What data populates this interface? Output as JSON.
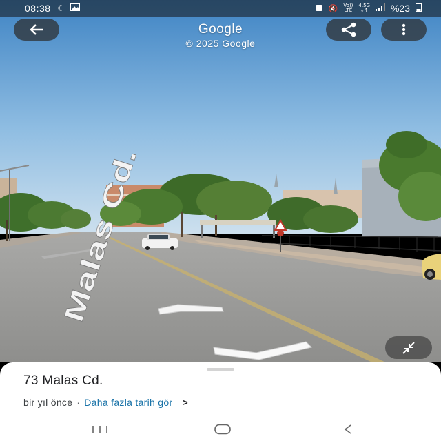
{
  "status_bar": {
    "time": "08:38",
    "left_icons": [
      "moon-icon",
      "image-icon"
    ],
    "network_labels": [
      "Vo))",
      "LTE",
      "4.5G"
    ],
    "battery": "%23"
  },
  "header": {
    "title": "Google",
    "copyright": "© 2025 Google"
  },
  "street_marking": "Malas Cd.",
  "location": {
    "address": "73 Malas Cd.",
    "capture_time": "bir yıl önce",
    "separator": "·",
    "more_dates_link": "Daha fazla tarih gör"
  },
  "icons": {
    "back": "arrow-left-icon",
    "share": "share-icon",
    "more": "more-vert-icon",
    "collapse": "collapse-icon",
    "chevron": "chevron-right-icon"
  },
  "colors": {
    "sky_top": "#4d8ec9",
    "sky_bottom": "#c6dced",
    "road": "#9e9e9e",
    "link": "#1a73a8"
  }
}
